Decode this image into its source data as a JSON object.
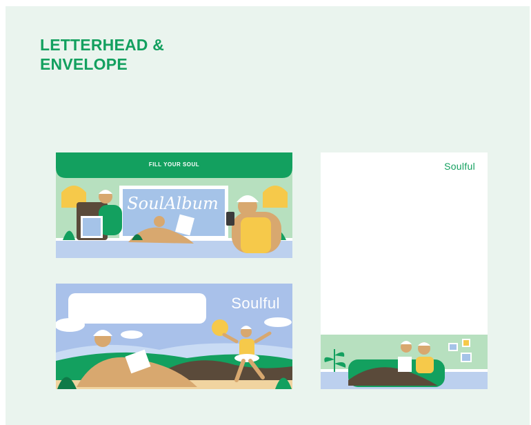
{
  "board": {
    "title_line1": "LETTERHEAD &",
    "title_line2": "ENVELOPE",
    "accent_color": "#13a05f"
  },
  "envelope_front": {
    "band_text": "FILL YOUR SOUL",
    "window_text": "SoulAlbum"
  },
  "envelope_back": {
    "brand": "Soulful"
  },
  "letterhead": {
    "brand": "Soulful"
  }
}
